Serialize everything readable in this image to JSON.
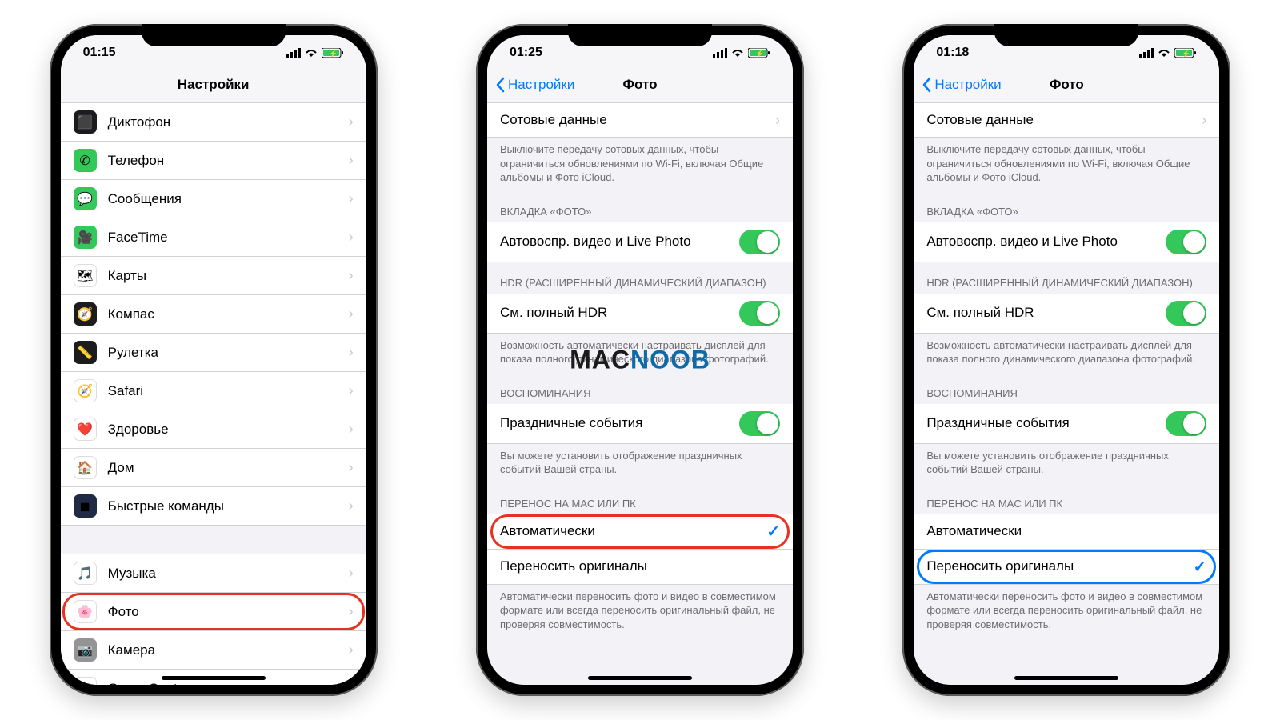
{
  "watermark": {
    "part1": "MAC",
    "part2": "NOOB"
  },
  "phone1": {
    "time": "01:15",
    "title": "Настройки",
    "groups": [
      {
        "items": [
          {
            "icon": "voice-memos-icon",
            "cls": "ic-voice",
            "glyph": "⬛",
            "label": "Диктофон"
          },
          {
            "icon": "phone-icon",
            "cls": "ic-phone",
            "glyph": "✆",
            "label": "Телефон"
          },
          {
            "icon": "messages-icon",
            "cls": "ic-msg",
            "glyph": "💬",
            "label": "Сообщения"
          },
          {
            "icon": "facetime-icon",
            "cls": "ic-ft",
            "glyph": "🎥",
            "label": "FaceTime"
          },
          {
            "icon": "maps-icon",
            "cls": "ic-maps",
            "glyph": "🗺",
            "label": "Карты"
          },
          {
            "icon": "compass-icon",
            "cls": "ic-compass",
            "glyph": "🧭",
            "label": "Компас"
          },
          {
            "icon": "measure-icon",
            "cls": "ic-measure",
            "glyph": "📏",
            "label": "Рулетка"
          },
          {
            "icon": "safari-icon",
            "cls": "ic-safari",
            "glyph": "🧭",
            "label": "Safari"
          },
          {
            "icon": "health-icon",
            "cls": "ic-health",
            "glyph": "❤️",
            "label": "Здоровье"
          },
          {
            "icon": "home-icon",
            "cls": "ic-home",
            "glyph": "🏠",
            "label": "Дом"
          },
          {
            "icon": "shortcuts-icon",
            "cls": "ic-shortcuts",
            "glyph": "◼",
            "label": "Быстрые команды"
          }
        ]
      },
      {
        "items": [
          {
            "icon": "music-icon",
            "cls": "ic-music",
            "glyph": "🎵",
            "label": "Музыка"
          },
          {
            "icon": "photos-icon",
            "cls": "ic-photos",
            "glyph": "🌸",
            "label": "Фото",
            "highlight": "red"
          },
          {
            "icon": "camera-icon",
            "cls": "ic-camera",
            "glyph": "📷",
            "label": "Камера"
          },
          {
            "icon": "gamecenter-icon",
            "cls": "ic-gc",
            "glyph": "🎮",
            "label": "Game Center"
          }
        ]
      }
    ]
  },
  "phone2": {
    "time": "01:25",
    "back": "Настройки",
    "title": "Фото",
    "cellular": {
      "label": "Сотовые данные",
      "footer": "Выключите передачу сотовых данных, чтобы ограничиться обновлениями по Wi-Fi, включая Общие альбомы и Фото iCloud."
    },
    "tab": {
      "header": "ВКЛАДКА «ФОТО»",
      "autoplay": "Автовоспр. видео и Live Photo"
    },
    "hdr": {
      "header": "HDR (РАСШИРЕННЫЙ ДИНАМИЧЕСКИЙ ДИАПАЗОН)",
      "label": "См. полный HDR",
      "footer": "Возможность автоматически настраивать дисплей для показа полного динамического диапазона фотографий."
    },
    "memories": {
      "header": "ВОСПОМИНАНИЯ",
      "label": "Праздничные события",
      "footer": "Вы можете установить отображение праздничных событий Вашей страны."
    },
    "transfer": {
      "header": "ПЕРЕНОС НА MAC ИЛИ ПК",
      "auto": "Автоматически",
      "orig": "Переносить оригиналы",
      "footer": "Автоматически переносить фото и видео в совместимом формате или всегда переносить оригинальный файл, не проверяя совместимость.",
      "selected": "auto",
      "highlight": "red"
    }
  },
  "phone3": {
    "time": "01:18",
    "back": "Настройки",
    "title": "Фото",
    "transfer": {
      "selected": "orig",
      "highlight": "blue"
    }
  }
}
